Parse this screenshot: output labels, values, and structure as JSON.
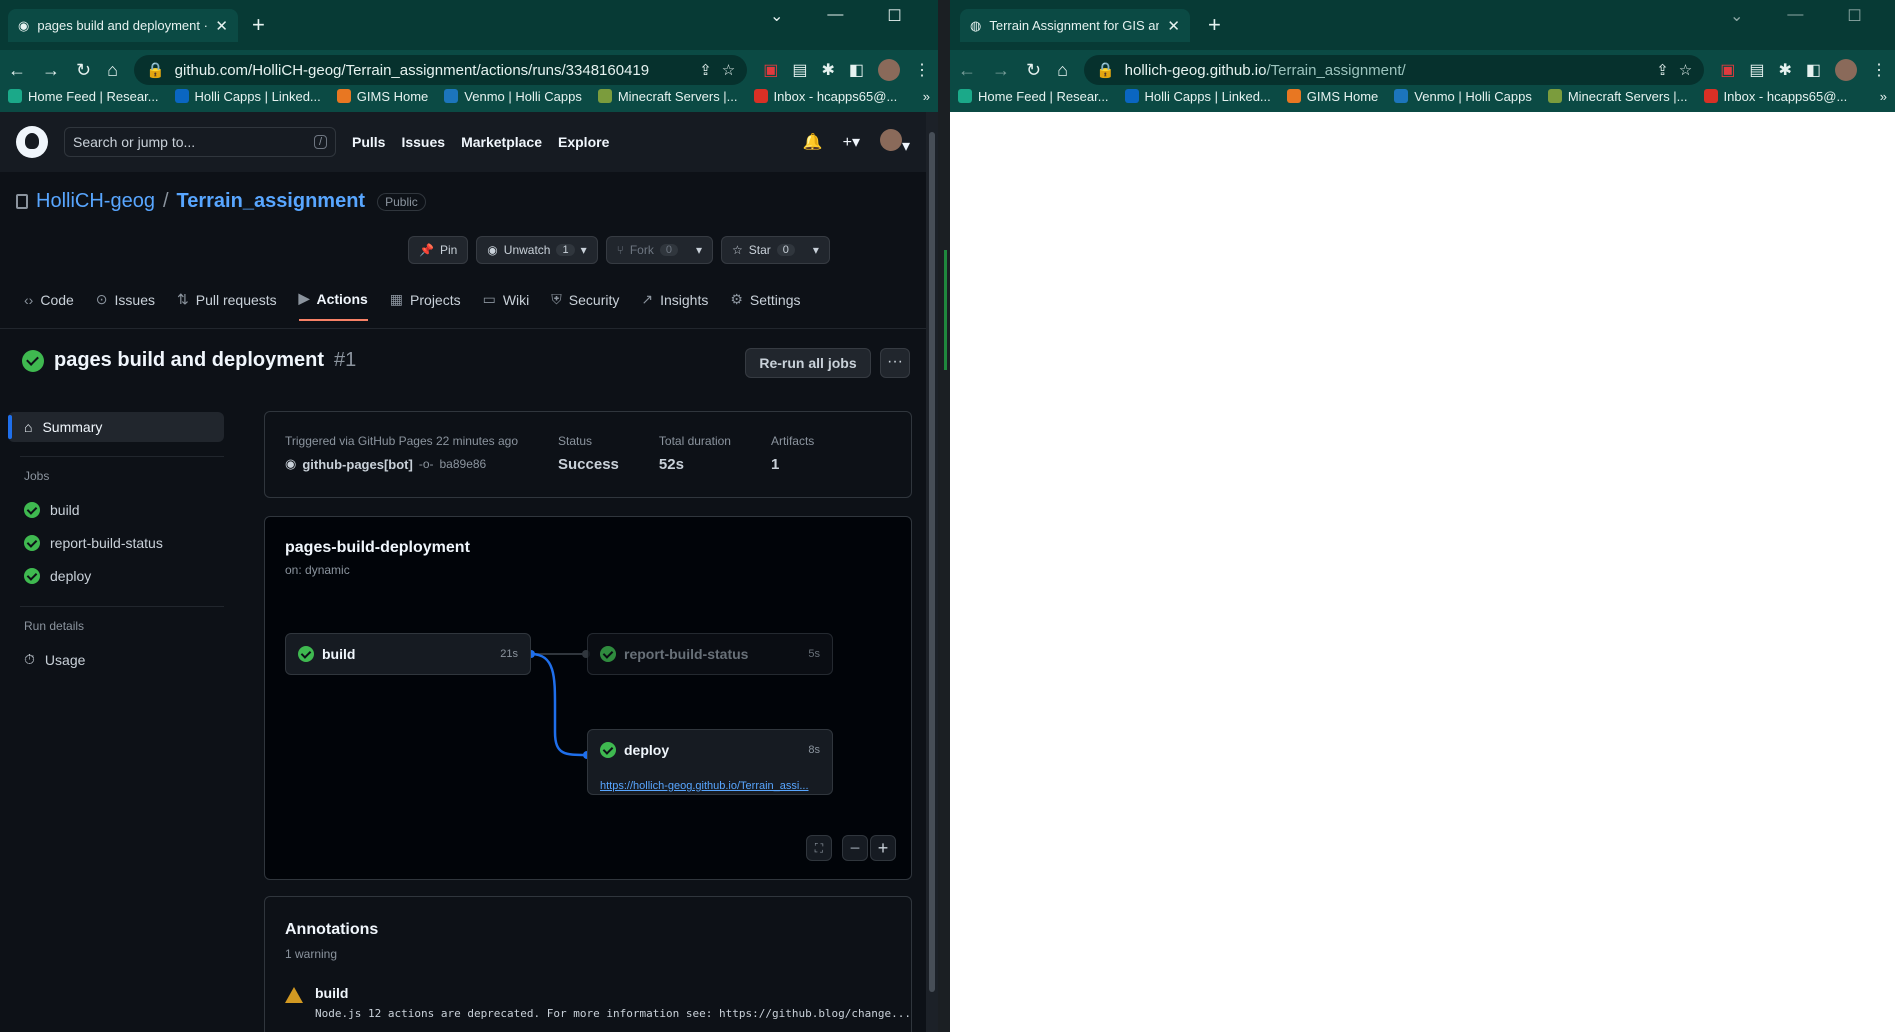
{
  "left_browser": {
    "tab_title": "pages build and deployment · Ho",
    "url": "github.com/HolliCH-geog/Terrain_assignment/actions/runs/3348160419"
  },
  "right_browser": {
    "tab_title": "Terrain Assignment for GIS and P",
    "url_host": "hollich-geog.github.io",
    "url_path": "/Terrain_assignment/"
  },
  "bookmarks": [
    "Home Feed | Resear...",
    "Holli Capps | Linked...",
    "GIMS Home",
    "Venmo | Holli Capps",
    "Minecraft Servers |...",
    "Inbox - hcapps65@..."
  ],
  "bookmark_colors": [
    "#1ba989",
    "#0a66c2",
    "#e87722",
    "#1c75bc",
    "#7b9c3d",
    "#d93025"
  ],
  "github": {
    "search_placeholder": "Search or jump to...",
    "search_hint": "/",
    "nav": [
      "Pulls",
      "Issues",
      "Marketplace",
      "Explore"
    ]
  },
  "repo": {
    "owner": "HolliCH-geog",
    "separator": "/",
    "name": "Terrain_assignment",
    "visibility": "Public",
    "pin": "Pin",
    "unwatch": "Unwatch",
    "unwatch_count": "1",
    "fork": "Fork",
    "fork_count": "0",
    "star": "Star",
    "star_count": "0",
    "tabs": [
      "Code",
      "Issues",
      "Pull requests",
      "Actions",
      "Projects",
      "Wiki",
      "Security",
      "Insights",
      "Settings"
    ],
    "tab_icons": [
      "‹›",
      "⊙",
      "⇅",
      "▶",
      "▦",
      "▭",
      "⛨",
      "↗",
      "⚙"
    ]
  },
  "run": {
    "title": "pages build and deployment",
    "number": "#1",
    "rerun": "Re-run all jobs",
    "more": "···",
    "triggered": "Triggered via GitHub Pages 22 minutes ago",
    "actor": "github-pages[bot]",
    "sha": "ba89e86",
    "status_label": "Status",
    "status": "Success",
    "duration_label": "Total duration",
    "duration": "52s",
    "artifacts_label": "Artifacts",
    "artifacts": "1"
  },
  "sidebar": {
    "summary": "Summary",
    "jobs_heading": "Jobs",
    "jobs": [
      "build",
      "report-build-status",
      "deploy"
    ],
    "run_details_heading": "Run details",
    "usage": "Usage"
  },
  "workflow": {
    "name": "pages-build-deployment",
    "trigger": "on: dynamic",
    "build": {
      "name": "build",
      "time": "21s"
    },
    "report": {
      "name": "report-build-status",
      "time": "5s"
    },
    "deploy": {
      "name": "deploy",
      "time": "8s",
      "link": "https://hollich-geog.github.io/Terrain_assi..."
    }
  },
  "annotations": {
    "title": "Annotations",
    "count": "1 warning",
    "job": "build",
    "message": "Node.js 12 actions are deprecated. For more information see: https://github.blog/change..."
  }
}
